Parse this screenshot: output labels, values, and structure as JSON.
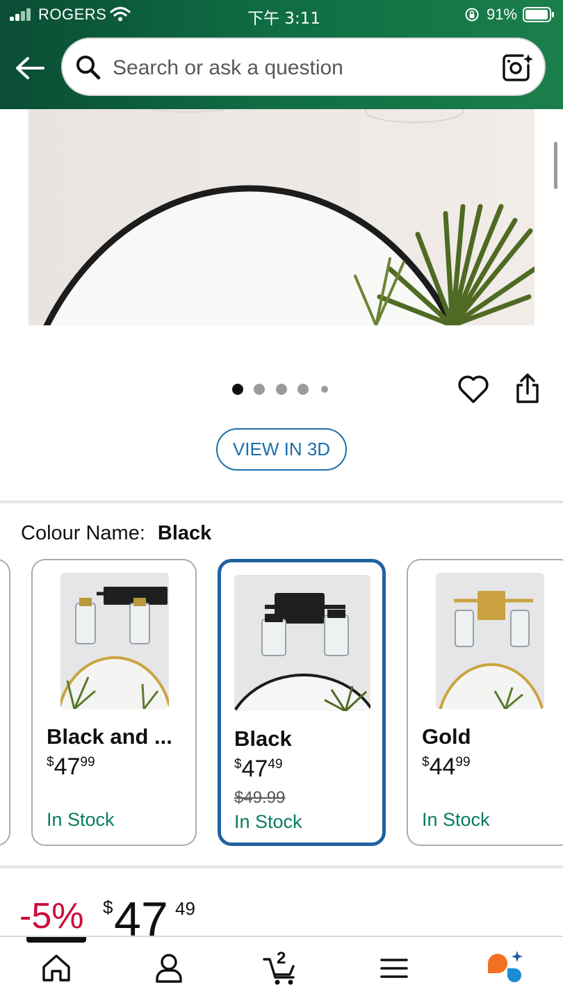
{
  "status_bar": {
    "carrier": "ROGERS",
    "time": "下午 3:11",
    "battery": "91%"
  },
  "search": {
    "placeholder": "Search or ask a question"
  },
  "gallery": {
    "image_count": 5,
    "active_index": 0
  },
  "actions": {
    "view_3d": "VIEW IN 3D"
  },
  "variants": {
    "label": "Colour Name:",
    "selected": "Black",
    "items": [
      {
        "name": "Black and ...",
        "price_whole": "47",
        "price_fraction": "99",
        "currency": "$",
        "was_price": "",
        "stock": "In Stock"
      },
      {
        "name": "Black",
        "price_whole": "47",
        "price_fraction": "49",
        "currency": "$",
        "was_price": "$49.99",
        "stock": "In Stock"
      },
      {
        "name": "Gold",
        "price_whole": "44",
        "price_fraction": "99",
        "currency": "$",
        "was_price": "",
        "stock": "In Stock"
      }
    ]
  },
  "price": {
    "discount": "-5%",
    "currency": "$",
    "whole": "47",
    "fraction": "49"
  },
  "tabbar": {
    "cart_count": "2",
    "items": [
      "home-icon",
      "account-icon",
      "cart-icon",
      "menu-icon",
      "rufus-assistant-icon"
    ]
  },
  "colors": {
    "header_start": "#0a4d35",
    "header_end": "#1b7f4b",
    "link_blue": "#1a6fa8",
    "selected_border": "#2162a1",
    "stock_green": "#067d62",
    "discount_red": "#cc0c39"
  }
}
